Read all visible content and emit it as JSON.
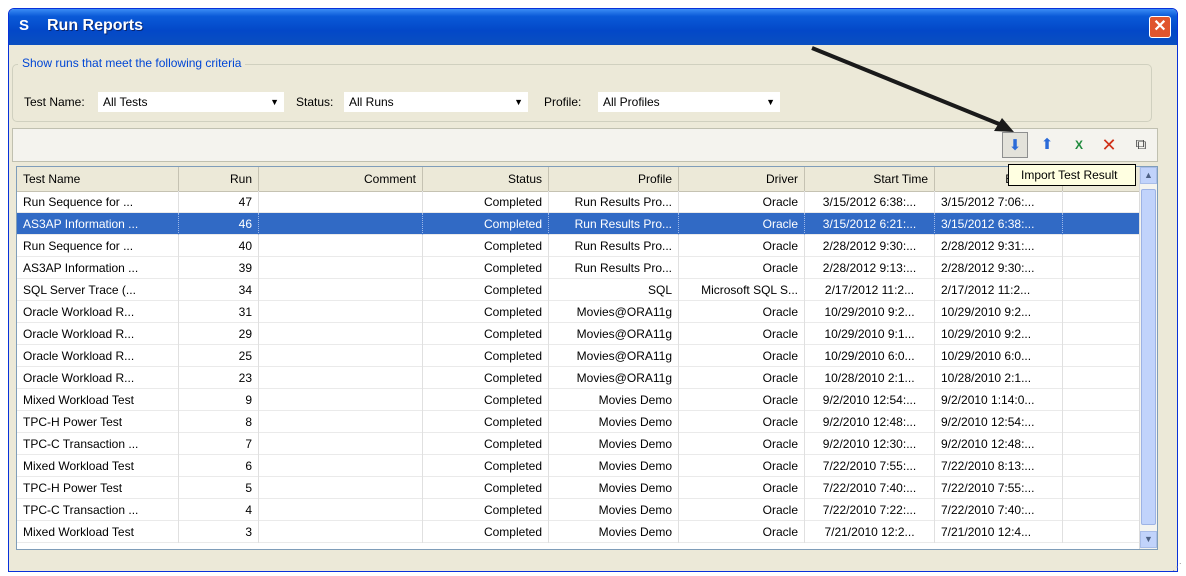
{
  "window": {
    "title": "Run Reports",
    "close_glyph": "✕",
    "app_icon": "app-logo-icon"
  },
  "criteria": {
    "legend": "Show runs that meet the following criteria",
    "test_name_label": "Test Name:",
    "test_name_value": "All Tests",
    "status_label": "Status:",
    "status_value": "All Runs",
    "profile_label": "Profile:",
    "profile_value": "All Profiles"
  },
  "toolbar": {
    "tooltip": "Import Test Result",
    "icons": [
      "import-icon",
      "export-icon",
      "excel-icon",
      "delete-icon",
      "properties-icon"
    ]
  },
  "table": {
    "columns": [
      "Test Name",
      "Run",
      "Comment",
      "Status",
      "Profile",
      "Driver",
      "Start Time",
      "End Time"
    ],
    "rows": [
      [
        "Run Sequence for ...",
        "47",
        "",
        "Completed",
        "Run Results Pro...",
        "Oracle",
        "3/15/2012 6:38:...",
        "3/15/2012 7:06:..."
      ],
      [
        "AS3AP Information ...",
        "46",
        "",
        "Completed",
        "Run Results Pro...",
        "Oracle",
        "3/15/2012 6:21:...",
        "3/15/2012 6:38:..."
      ],
      [
        "Run Sequence for ...",
        "40",
        "",
        "Completed",
        "Run Results Pro...",
        "Oracle",
        "2/28/2012 9:30:...",
        "2/28/2012 9:31:..."
      ],
      [
        "AS3AP Information ...",
        "39",
        "",
        "Completed",
        "Run Results Pro...",
        "Oracle",
        "2/28/2012 9:13:...",
        "2/28/2012 9:30:..."
      ],
      [
        "SQL Server Trace (...",
        "34",
        "",
        "Completed",
        "SQL",
        "Microsoft SQL S...",
        "2/17/2012 11:2...",
        "2/17/2012 11:2..."
      ],
      [
        "Oracle Workload R...",
        "31",
        "",
        "Completed",
        "Movies@ORA11g",
        "Oracle",
        "10/29/2010 9:2...",
        "10/29/2010 9:2..."
      ],
      [
        "Oracle Workload R...",
        "29",
        "",
        "Completed",
        "Movies@ORA11g",
        "Oracle",
        "10/29/2010 9:1...",
        "10/29/2010 9:2..."
      ],
      [
        "Oracle Workload R...",
        "25",
        "",
        "Completed",
        "Movies@ORA11g",
        "Oracle",
        "10/29/2010 6:0...",
        "10/29/2010 6:0..."
      ],
      [
        "Oracle Workload R...",
        "23",
        "",
        "Completed",
        "Movies@ORA11g",
        "Oracle",
        "10/28/2010 2:1...",
        "10/28/2010 2:1..."
      ],
      [
        "Mixed Workload Test",
        "9",
        "",
        "Completed",
        "Movies Demo",
        "Oracle",
        "9/2/2010 12:54:...",
        "9/2/2010 1:14:0..."
      ],
      [
        "TPC-H Power Test",
        "8",
        "",
        "Completed",
        "Movies Demo",
        "Oracle",
        "9/2/2010 12:48:...",
        "9/2/2010 12:54:..."
      ],
      [
        "TPC-C Transaction ...",
        "7",
        "",
        "Completed",
        "Movies Demo",
        "Oracle",
        "9/2/2010 12:30:...",
        "9/2/2010 12:48:..."
      ],
      [
        "Mixed Workload Test",
        "6",
        "",
        "Completed",
        "Movies Demo",
        "Oracle",
        "7/22/2010 7:55:...",
        "7/22/2010 8:13:..."
      ],
      [
        "TPC-H Power Test",
        "5",
        "",
        "Completed",
        "Movies Demo",
        "Oracle",
        "7/22/2010 7:40:...",
        "7/22/2010 7:55:..."
      ],
      [
        "TPC-C Transaction ...",
        "4",
        "",
        "Completed",
        "Movies Demo",
        "Oracle",
        "7/22/2010 7:22:...",
        "7/22/2010 7:40:..."
      ],
      [
        "Mixed Workload Test",
        "3",
        "",
        "Completed",
        "Movies Demo",
        "Oracle",
        "7/21/2010 12:2...",
        "7/21/2010 12:4..."
      ]
    ],
    "selected_index": 1
  },
  "colors": {
    "selection": "#316ac5",
    "titlebar": "#0a5ad8",
    "legend_text": "#0046d5"
  }
}
